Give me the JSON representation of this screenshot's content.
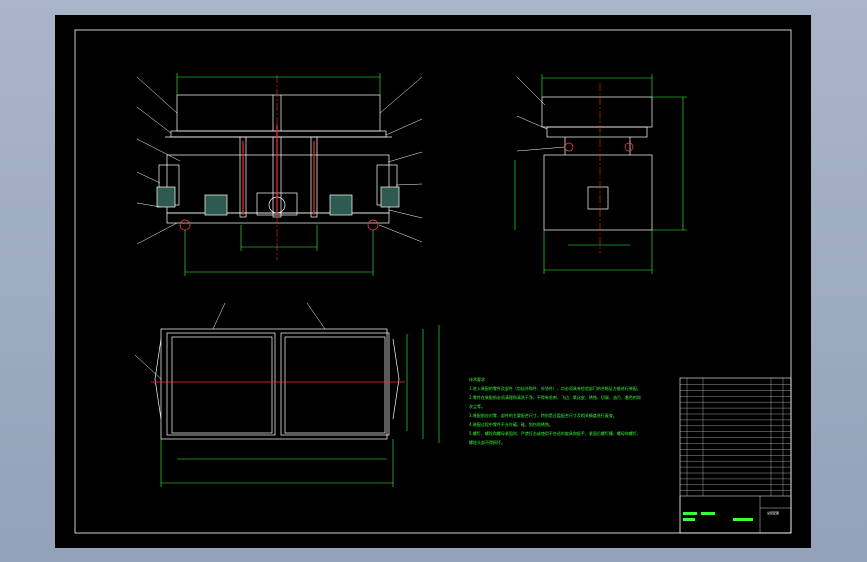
{
  "colors": {
    "background": "#000000",
    "outline": "#ffffff",
    "dimension": "#39ff3a",
    "centerline": "#ff2a2a",
    "hidden": "#9a9a9a",
    "part_fill": "#2f5a52"
  },
  "tech_requirements": {
    "lines": [
      "技术要求",
      "1.进入装配的零件及部件（包括外购件、外协件），均必须具有检验部门的合格证方能进行装配。",
      "2.零件在装配前必须清理和清洗干净，不得有毛刺、飞边、氧化皮、锈蚀、切屑、油污、着色剂和",
      "灰尘等。",
      "3.装配前应对零、部件的主要配合尺寸，特别是过盈配合尺寸及相关精度进行复查。",
      "4.装配过程中零件不允许磕、碰、划伤和锈蚀。",
      "5.螺钉、螺栓和螺母紧固时，严禁打击或使用不合适的旋具和扳手。紧固后螺钉槽、螺母和螺钉、",
      "螺栓头部不得损坏。"
    ]
  },
  "title_block": {
    "drawing_title": "总装配图"
  }
}
